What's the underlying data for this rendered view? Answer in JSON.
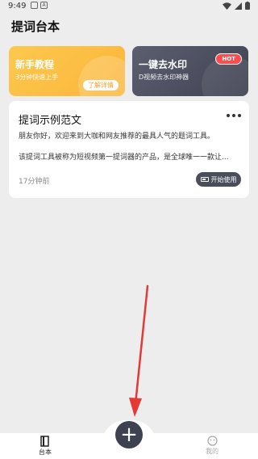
{
  "status_bar": {
    "time": "9:49",
    "icon_a": "A"
  },
  "app_title": "提词台本",
  "promos": [
    {
      "title": "新手教程",
      "subtitle": "3分钟快速上手",
      "button": "了解详情"
    },
    {
      "title": "一键去水印",
      "subtitle": "D视频去水印神器",
      "badge": "HOT"
    }
  ],
  "script_card": {
    "title": "提词示例范文",
    "paragraph1": "朋友你好，欢迎来到大咖和网友推荐的最具人气的题词工具。",
    "paragraph2": "该提词工具被称为短视频第一提词器的产品，是全球唯一一款让...",
    "time": "17分钟前",
    "start_label": "开始使用"
  },
  "nav": {
    "home_label": "台本",
    "mine_label": "我的",
    "fab_label": "+"
  },
  "colors": {
    "tutorial_card": "#fbb53a",
    "watermark_card": "#4a4d5c",
    "hot_badge": "#ff4d4f",
    "fab": "#3e4150",
    "arrow": "#e53935"
  }
}
